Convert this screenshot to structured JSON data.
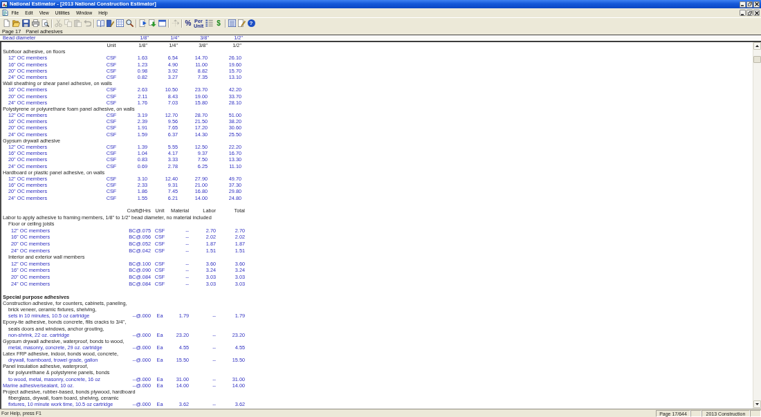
{
  "window": {
    "title": "National Estimator - [2013 National Construction Estimator]"
  },
  "menu": [
    "File",
    "Edit",
    "View",
    "Utilities",
    "Window",
    "Help"
  ],
  "toolbar": [
    [
      {
        "disabled": false
      },
      {
        "disabled": false
      },
      {
        "disabled": false
      },
      {
        "disabled": false
      },
      {
        "disabled": false
      }
    ],
    [
      {
        "disabled": true
      },
      {
        "disabled": true
      },
      {
        "disabled": true
      },
      {
        "disabled": true
      }
    ],
    [
      {
        "disabled": false
      },
      {
        "disabled": false
      },
      {
        "disabled": false
      },
      {
        "disabled": false
      }
    ],
    [
      {
        "disabled": false
      },
      {
        "disabled": false
      },
      {
        "disabled": false
      }
    ],
    [
      {
        "disabled": true
      }
    ],
    [
      {
        "label": "%",
        "disabled": false
      },
      {
        "label": "Per Unit",
        "disabled": false
      },
      {
        "disabled": false
      },
      {
        "label": "$",
        "disabled": false
      }
    ],
    [
      {
        "disabled": false
      },
      {
        "disabled": false
      },
      {
        "label": "?",
        "disabled": false
      }
    ]
  ],
  "page": {
    "number": "Page 17",
    "title": "Panel adhesives"
  },
  "header": {
    "label": "Bead diameter",
    "columns": [
      "1/8\"",
      "1/4\"",
      "3/8\"",
      "1/2\""
    ]
  },
  "tables": [
    {
      "kind": "sizes",
      "columns": [
        "Unit",
        "1/8\"",
        "1/4\"",
        "3/8\"",
        "1/2\""
      ],
      "rows": [
        {
          "text": "Subfloor adhesive, on floors",
          "children": [
            {
              "text": "12\" OC members",
              "cells": [
                "CSF",
                "1.63",
                "6.54",
                "14.70",
                "26.10"
              ]
            },
            {
              "text": "16\" OC members",
              "cells": [
                "CSF",
                "1.23",
                "4.90",
                "11.00",
                "19.60"
              ]
            },
            {
              "text": "20\" OC members",
              "cells": [
                "CSF",
                "0.98",
                "3.92",
                "8.82",
                "15.70"
              ]
            },
            {
              "text": "24\" OC members",
              "cells": [
                "CSF",
                "0.82",
                "3.27",
                "7.35",
                "13.10"
              ]
            }
          ]
        },
        {
          "text": "Wall sheathing or shear panel adhesive, on walls",
          "children": [
            {
              "text": "16\" OC members",
              "cells": [
                "CSF",
                "2.63",
                "10.50",
                "23.70",
                "42.20"
              ]
            },
            {
              "text": "20\" OC members",
              "cells": [
                "CSF",
                "2.11",
                "8.43",
                "19.00",
                "33.70"
              ]
            },
            {
              "text": "24\" OC members",
              "cells": [
                "CSF",
                "1.76",
                "7.03",
                "15.80",
                "28.10"
              ]
            }
          ]
        },
        {
          "text": "Polystyrene or polyurethane foam panel adhesive, on walls",
          "children": [
            {
              "text": "12\" OC members",
              "cells": [
                "CSF",
                "3.19",
                "12.70",
                "28.70",
                "51.00"
              ]
            },
            {
              "text": "16\" OC members",
              "cells": [
                "CSF",
                "2.39",
                "9.56",
                "21.50",
                "38.20"
              ]
            },
            {
              "text": "20\" OC members",
              "cells": [
                "CSF",
                "1.91",
                "7.65",
                "17.20",
                "30.60"
              ]
            },
            {
              "text": "24\" OC members",
              "cells": [
                "CSF",
                "1.59",
                "6.37",
                "14.30",
                "25.50"
              ]
            }
          ]
        },
        {
          "text": "Gypsum drywall adhesive",
          "children": [
            {
              "text": "12\" OC members",
              "cells": [
                "CSF",
                "1.39",
                "5.55",
                "12.50",
                "22.20"
              ]
            },
            {
              "text": "16\" OC members",
              "cells": [
                "CSF",
                "1.04",
                "4.17",
                "9.37",
                "16.70"
              ]
            },
            {
              "text": "20\" OC members",
              "cells": [
                "CSF",
                "0.83",
                "3.33",
                "7.50",
                "13.30"
              ]
            },
            {
              "text": "24\" OC members",
              "cells": [
                "CSF",
                "0.69",
                "2.78",
                "6.25",
                "11.10"
              ]
            }
          ]
        },
        {
          "text": "Hardboard or plastic panel adhesive, on walls",
          "children": [
            {
              "text": "12\" OC members",
              "cells": [
                "CSF",
                "3.10",
                "12.40",
                "27.90",
                "49.70"
              ]
            },
            {
              "text": "16\" OC members",
              "cells": [
                "CSF",
                "2.33",
                "9.31",
                "21.00",
                "37.30"
              ]
            },
            {
              "text": "20\" OC members",
              "cells": [
                "CSF",
                "1.86",
                "7.45",
                "16.80",
                "29.80"
              ]
            },
            {
              "text": "24\" OC members",
              "cells": [
                "CSF",
                "1.55",
                "6.21",
                "14.00",
                "24.80"
              ]
            }
          ]
        }
      ]
    },
    {
      "kind": "costs",
      "columns": [
        "Craft@Hrs",
        "Unit",
        "Material",
        "Labor",
        "Total"
      ],
      "rows": [
        {
          "text": "Labor to apply adhesive to framing members, 1/8\" to 1/2\" bead diameter, no material included",
          "children": [
            {
              "text": "Floor or ceiling joists",
              "children": [
                {
                  "text": "12\" OC members",
                  "cells": [
                    "BC@.075",
                    "CSF",
                    "--",
                    "2.70",
                    "2.70"
                  ]
                },
                {
                  "text": "16\" OC members",
                  "cells": [
                    "BC@.056",
                    "CSF",
                    "--",
                    "2.02",
                    "2.02"
                  ]
                },
                {
                  "text": "20\" OC members",
                  "cells": [
                    "BC@.052",
                    "CSF",
                    "--",
                    "1.87",
                    "1.87"
                  ]
                },
                {
                  "text": "24\" OC members",
                  "cells": [
                    "BC@.042",
                    "CSF",
                    "--",
                    "1.51",
                    "1.51"
                  ]
                }
              ]
            },
            {
              "text": "Interior and exterior wall members",
              "children": [
                {
                  "text": "12\" OC members",
                  "cells": [
                    "BC@.100",
                    "CSF",
                    "--",
                    "3.60",
                    "3.60"
                  ]
                },
                {
                  "text": "16\" OC members",
                  "cells": [
                    "BC@.090",
                    "CSF",
                    "--",
                    "3.24",
                    "3.24"
                  ]
                },
                {
                  "text": "20\" OC members",
                  "cells": [
                    "BC@.084",
                    "CSF",
                    "--",
                    "3.03",
                    "3.03"
                  ]
                },
                {
                  "text": "24\" OC members",
                  "cells": [
                    "BC@.084",
                    "CSF",
                    "--",
                    "3.03",
                    "3.03"
                  ]
                }
              ]
            }
          ]
        }
      ]
    },
    {
      "kind": "costs",
      "title": "Special purpose adhesives",
      "rows": [
        {
          "lines": [
            "Construction adhesive, for counters, cabinets, paneling,",
            "brick veneer, ceramic fixtures, shelving,",
            "sets in 10 minutes, 10.5 oz cartridge"
          ],
          "cells": [
            "--@.000",
            "Ea",
            "1.79",
            "--",
            "1.79"
          ]
        },
        {
          "lines": [
            "Epoxy-tie adhesive, bonds concrete, fills cracks to 3/4\",",
            "seals doors and windows, anchor grouting,",
            "non-shrink, 22 oz. cartridge"
          ],
          "cells": [
            "--@.000",
            "Ea",
            "23.20",
            "--",
            "23.20"
          ]
        },
        {
          "lines": [
            "Gypsum drywall adhesive, waterproof, bonds to wood,",
            "metal, masonry, concrete, 29 oz. cartridge"
          ],
          "cells": [
            "--@.000",
            "Ea",
            "4.55",
            "--",
            "4.55"
          ]
        },
        {
          "lines": [
            "Latex FRP adhesive, indoor, bonds wood, concrete,",
            "drywall, foamboard, trowel grade, gallon"
          ],
          "cells": [
            "--@.000",
            "Ea",
            "15.50",
            "--",
            "15.50"
          ]
        },
        {
          "lines": [
            "Panel insulation adhesive, waterproof,",
            "for polyurethane & polystyrene panels, bonds",
            "to wood, metal, masonry, concrete, 16 oz"
          ],
          "cells": [
            "--@.000",
            "Ea",
            "31.00",
            "--",
            "31.00"
          ]
        },
        {
          "lines": [
            "Marine adhesive/sealant, 10 oz."
          ],
          "cells": [
            "--@.000",
            "Ea",
            "14.00",
            "--",
            "14.00"
          ]
        },
        {
          "lines": [
            "Project adhesive, rubber-based, bonds plywood, hardboard",
            "fiberglass, drywall, foam board, shelving, ceramic",
            "fixtures, 10 minute work time, 10.5 oz cartridge"
          ],
          "cells": [
            "--@.000",
            "Ea",
            "3.62",
            "--",
            "3.62"
          ]
        }
      ]
    }
  ],
  "status_bar": {
    "help": "For Help, press F1",
    "page": "Page 17/644",
    "edition": "2013 Construction"
  }
}
